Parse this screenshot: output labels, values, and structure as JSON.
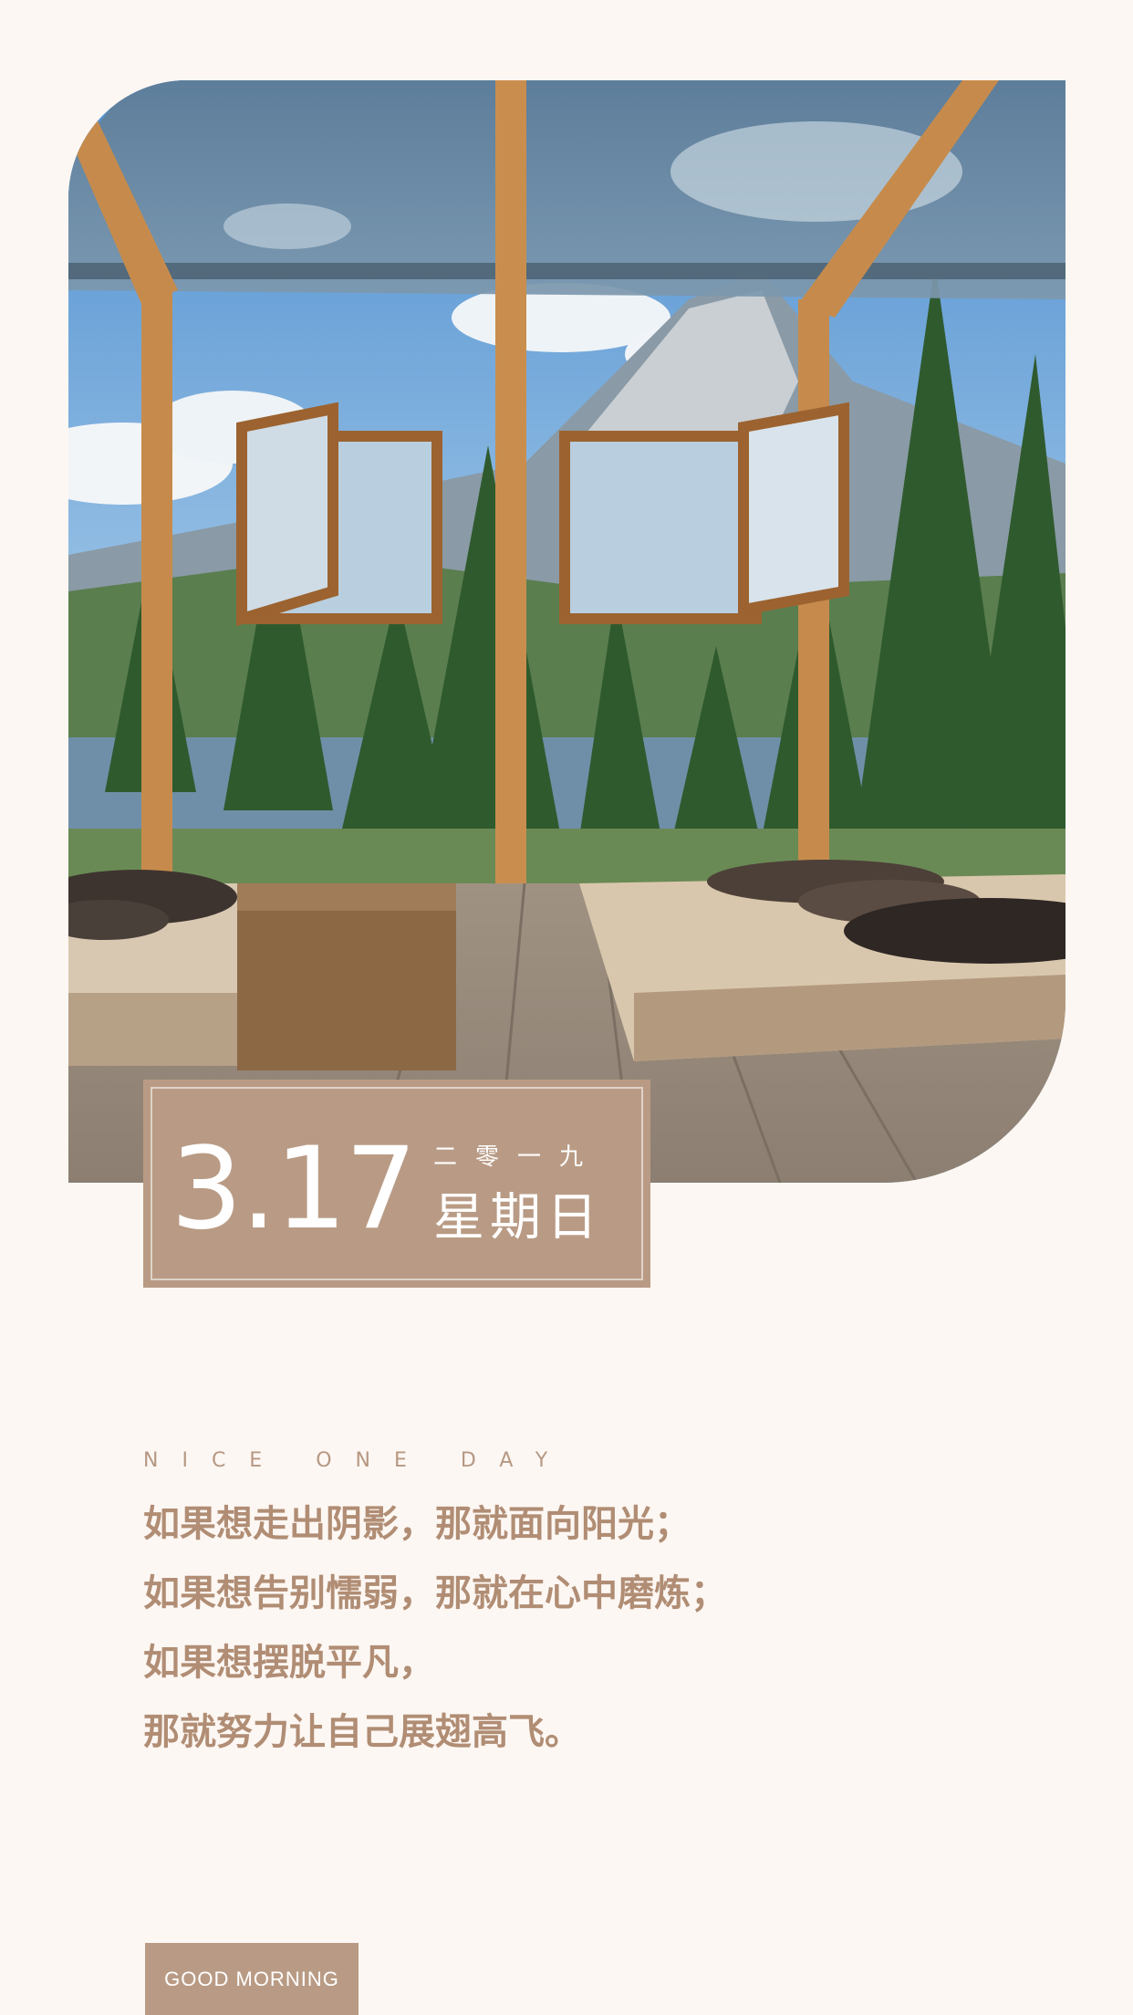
{
  "card": {
    "date": "3.17",
    "year": "二零一九",
    "weekday": "星期日"
  },
  "tagline": "NICE ONE DAY",
  "poem": [
    "如果想走出阴影，那就面向阳光；",
    "如果想告别懦弱，那就在心中磨炼；",
    "如果想摆脱平凡，",
    "那就努力让自己展翅高飞。"
  ],
  "button": {
    "label": "GOOD MORNING"
  },
  "colors": {
    "background": "#fdf7f3",
    "accent": "#b99b85",
    "text": "#b08d74"
  }
}
